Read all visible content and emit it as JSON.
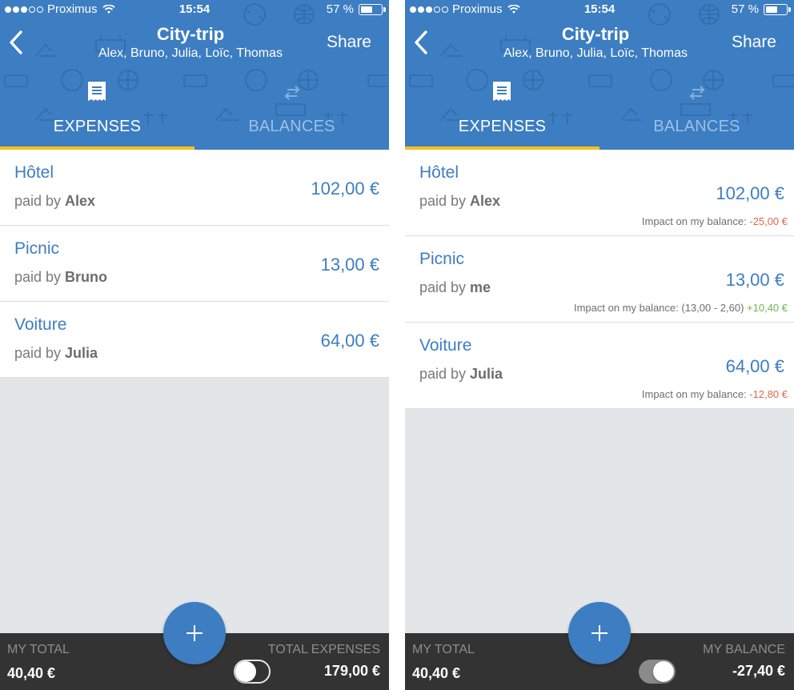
{
  "colors": {
    "header_blue": "#3d7dc2",
    "tab_underline": "#f1c21b",
    "negative": "#e0674a",
    "positive": "#6cb352",
    "footer": "#333333"
  },
  "screens": [
    {
      "status": {
        "carrier": "Proximus",
        "time": "15:54",
        "battery": "57 %"
      },
      "nav": {
        "title": "City-trip",
        "subtitle": "Alex, Bruno, Julia, Loïc, Thomas",
        "share": "Share"
      },
      "tabs": {
        "expenses": "EXPENSES",
        "balances": "BALANCES",
        "selected": "expenses"
      },
      "items": [
        {
          "name": "Hôtel",
          "paid_prefix": "paid by ",
          "payer": "Alex",
          "amount": "102,00 €"
        },
        {
          "name": "Picnic",
          "paid_prefix": "paid by ",
          "payer": "Bruno",
          "amount": "13,00 €"
        },
        {
          "name": "Voiture",
          "paid_prefix": "paid by ",
          "payer": "Julia",
          "amount": "64,00 €"
        }
      ],
      "footer": {
        "left_label": "MY TOTAL",
        "left_value": "40,40 €",
        "right_label": "TOTAL EXPENSES",
        "right_value": "179,00 €",
        "toggle_on": false
      }
    },
    {
      "status": {
        "carrier": "Proximus",
        "time": "15:54",
        "battery": "57 %"
      },
      "nav": {
        "title": "City-trip",
        "subtitle": "Alex, Bruno, Julia, Loïc, Thomas",
        "share": "Share"
      },
      "tabs": {
        "expenses": "EXPENSES",
        "balances": "BALANCES",
        "selected": "expenses"
      },
      "items": [
        {
          "name": "Hôtel",
          "paid_prefix": "paid by ",
          "payer": "Alex",
          "amount": "102,00 €",
          "impact_prefix": "Impact on my balance: ",
          "impact_detail": "",
          "impact_value": "-25,00 €"
        },
        {
          "name": "Picnic",
          "paid_prefix": "paid by ",
          "payer": "me",
          "amount": "13,00 €",
          "impact_prefix": "Impact on my balance: ",
          "impact_detail": "(13,00 - 2,60) ",
          "impact_value": "+10,40 €"
        },
        {
          "name": "Voiture",
          "paid_prefix": "paid by ",
          "payer": "Julia",
          "amount": "64,00 €",
          "impact_prefix": "Impact on my balance: ",
          "impact_detail": "",
          "impact_value": "-12,80 €"
        }
      ],
      "footer": {
        "left_label": "MY TOTAL",
        "left_value": "40,40 €",
        "right_label": "MY BALANCE",
        "right_value": "-27,40 €",
        "toggle_on": true
      }
    }
  ]
}
